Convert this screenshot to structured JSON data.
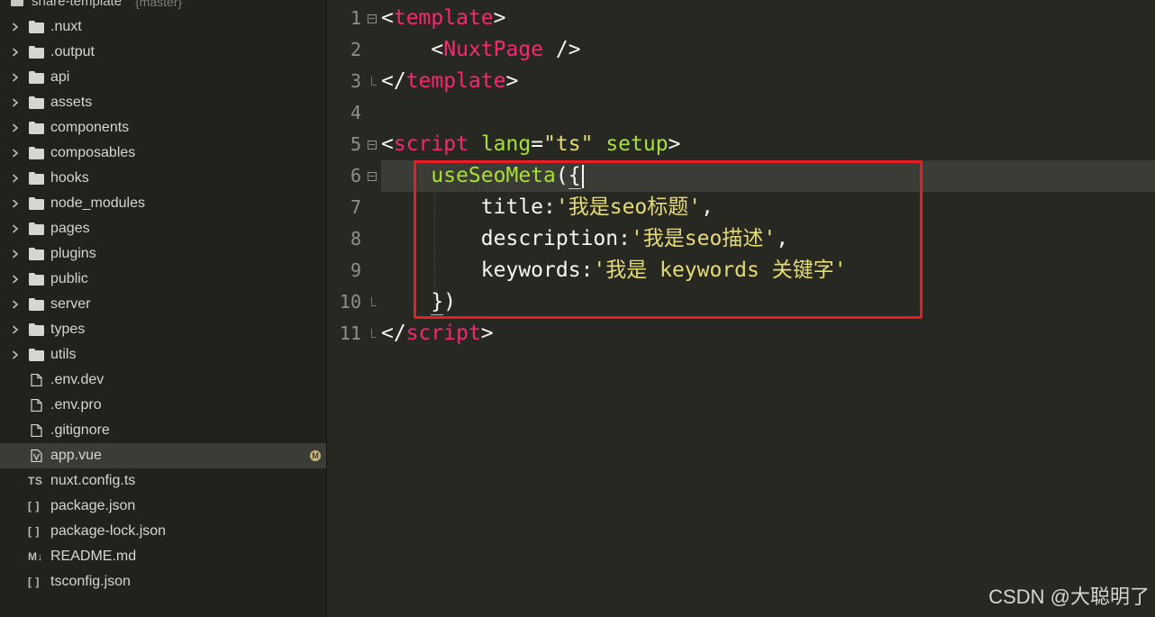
{
  "project": {
    "name": "share-template",
    "branch": "{master}"
  },
  "tree": [
    {
      "label": ".nuxt",
      "kind": "folder"
    },
    {
      "label": ".output",
      "kind": "folder"
    },
    {
      "label": "api",
      "kind": "folder"
    },
    {
      "label": "assets",
      "kind": "folder"
    },
    {
      "label": "components",
      "kind": "folder"
    },
    {
      "label": "composables",
      "kind": "folder"
    },
    {
      "label": "hooks",
      "kind": "folder"
    },
    {
      "label": "node_modules",
      "kind": "folder"
    },
    {
      "label": "pages",
      "kind": "folder"
    },
    {
      "label": "plugins",
      "kind": "folder"
    },
    {
      "label": "public",
      "kind": "folder"
    },
    {
      "label": "server",
      "kind": "folder"
    },
    {
      "label": "types",
      "kind": "folder"
    },
    {
      "label": "utils",
      "kind": "folder"
    },
    {
      "label": ".env.dev",
      "kind": "file"
    },
    {
      "label": ".env.pro",
      "kind": "file"
    },
    {
      "label": ".gitignore",
      "kind": "file"
    },
    {
      "label": "app.vue",
      "kind": "vue-file",
      "active": true,
      "badge": "M"
    },
    {
      "label": "nuxt.config.ts",
      "kind": "ts-file",
      "type_glyph": "TS"
    },
    {
      "label": "package.json",
      "kind": "json-file",
      "type_glyph": "[ ]"
    },
    {
      "label": "package-lock.json",
      "kind": "json-file",
      "type_glyph": "[ ]"
    },
    {
      "label": "README.md",
      "kind": "md-file",
      "type_glyph": "M↓"
    },
    {
      "label": "tsconfig.json",
      "kind": "json-file",
      "type_glyph": "[ ]"
    }
  ],
  "editor": {
    "line_numbers": [
      "1",
      "2",
      "3",
      "4",
      "5",
      "6",
      "7",
      "8",
      "9",
      "10",
      "11"
    ],
    "lines": [
      [
        {
          "t": "<",
          "c": "punc"
        },
        {
          "t": "template",
          "c": "tag"
        },
        {
          "t": ">",
          "c": "punc"
        }
      ],
      [
        {
          "t": "    <",
          "c": "punc"
        },
        {
          "t": "NuxtPage",
          "c": "tag"
        },
        {
          "t": " />",
          "c": "punc"
        }
      ],
      [
        {
          "t": "</",
          "c": "punc"
        },
        {
          "t": "template",
          "c": "tag"
        },
        {
          "t": ">",
          "c": "punc"
        }
      ],
      [],
      [
        {
          "t": "<",
          "c": "punc"
        },
        {
          "t": "script",
          "c": "tag"
        },
        {
          "t": " ",
          "c": "punc"
        },
        {
          "t": "lang",
          "c": "fn"
        },
        {
          "t": "=",
          "c": "punc"
        },
        {
          "t": "\"ts\"",
          "c": "str"
        },
        {
          "t": " ",
          "c": "punc"
        },
        {
          "t": "setup",
          "c": "fn"
        },
        {
          "t": ">",
          "c": "punc"
        }
      ],
      [
        {
          "t": "    ",
          "c": "punc"
        },
        {
          "t": "useSeoMeta",
          "c": "fn"
        },
        {
          "t": "(",
          "c": "punc"
        },
        {
          "t": "{",
          "c": "punc",
          "hl": true
        },
        {
          "caret": true
        }
      ],
      [
        {
          "t": "        title:",
          "c": "punc"
        },
        {
          "t": "'我是seo标题'",
          "c": "str"
        },
        {
          "t": ",",
          "c": "punc"
        }
      ],
      [
        {
          "t": "        description:",
          "c": "punc"
        },
        {
          "t": "'我是seo描述'",
          "c": "str"
        },
        {
          "t": ",",
          "c": "punc"
        }
      ],
      [
        {
          "t": "        keywords:",
          "c": "punc"
        },
        {
          "t": "'我是 keywords 关键字'",
          "c": "str"
        }
      ],
      [
        {
          "t": "    ",
          "c": "punc"
        },
        {
          "t": "}",
          "c": "punc",
          "hl": true
        },
        {
          "t": ")",
          "c": "punc"
        }
      ],
      [
        {
          "t": "</",
          "c": "punc"
        },
        {
          "t": "script",
          "c": "tag"
        },
        {
          "t": ">",
          "c": "punc"
        }
      ]
    ],
    "fold_open_lines": [
      1,
      5,
      6
    ],
    "fold_end_lines": [
      3,
      10,
      11
    ],
    "current_line": 6
  },
  "watermark": "CSDN @大聪明了",
  "colors": {
    "background": "#272822",
    "sidebar": "#21221d",
    "keyword": "#f92672",
    "function": "#a6e22e",
    "string": "#e6db74",
    "annotation": "#ec1c24"
  }
}
